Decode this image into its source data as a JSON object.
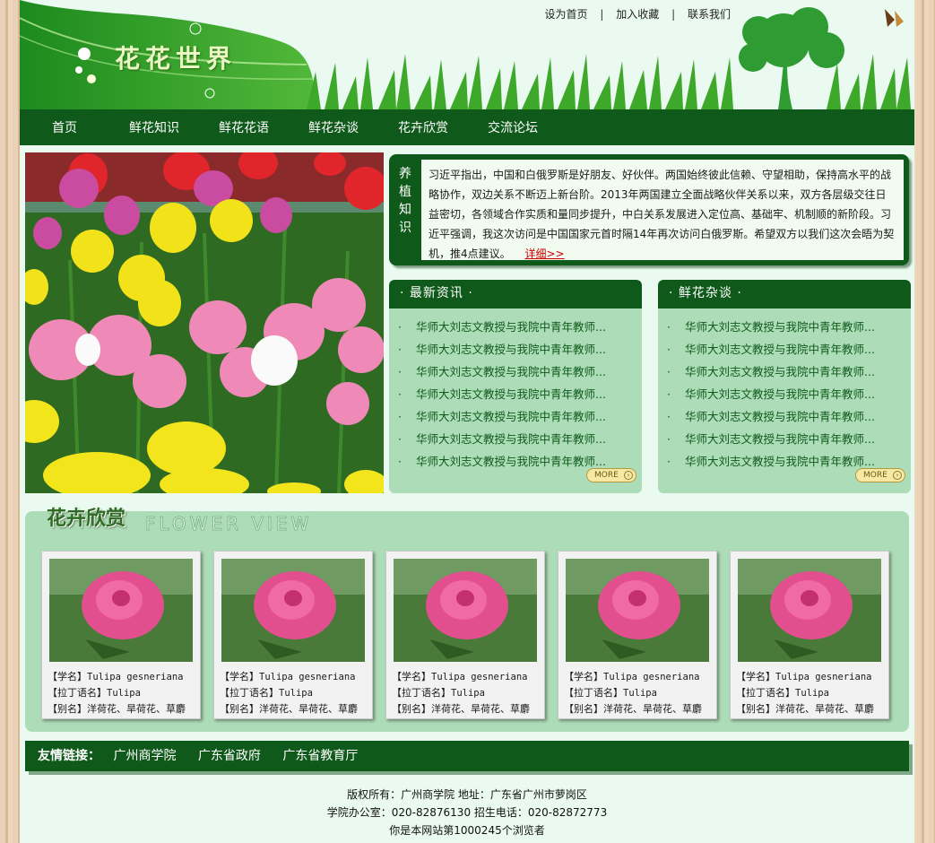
{
  "header": {
    "site_title": "花花世界",
    "top_links": [
      "设为首页",
      "加入收藏",
      "联系我们"
    ],
    "separator": "|"
  },
  "nav": [
    "首页",
    "鲜花知识",
    "鲜花花语",
    "鲜花杂谈",
    "花卉欣赏",
    "交流论坛"
  ],
  "care": {
    "label": [
      "养",
      "植",
      "知",
      "识"
    ],
    "text": "习近平指出，中国和白俄罗斯是好朋友、好伙伴。两国始终彼此信赖、守望相助，保持高水平的战略协作，双边关系不断迈上新台阶。2013年两国建立全面战略伙伴关系以来，双方各层级交往日益密切，各领域合作实质和量同步提升，中白关系发展进入定位高、基础牢、机制顺的新阶段。习近平强调，我这次访问是中国国家元首时隔14年再次访问白俄罗斯。希望双方以我们这次会晤为契机，推4点建议。",
    "more": "详细>>"
  },
  "panels": [
    {
      "title": "· 最新资讯 ·",
      "items": [
        "华师大刘志文教授与我院中青年教师...",
        "华师大刘志文教授与我院中青年教师...",
        "华师大刘志文教授与我院中青年教师...",
        "华师大刘志文教授与我院中青年教师...",
        "华师大刘志文教授与我院中青年教师...",
        "华师大刘志文教授与我院中青年教师...",
        "华师大刘志文教授与我院中青年教师..."
      ],
      "more": "MORE"
    },
    {
      "title": "· 鲜花杂谈 ·",
      "items": [
        "华师大刘志文教授与我院中青年教师...",
        "华师大刘志文教授与我院中青年教师...",
        "华师大刘志文教授与我院中青年教师...",
        "华师大刘志文教授与我院中青年教师...",
        "华师大刘志文教授与我院中青年教师...",
        "华师大刘志文教授与我院中青年教师...",
        "华师大刘志文教授与我院中青年教师..."
      ],
      "more": "MORE"
    }
  ],
  "list_bullet": "·",
  "flower_view": {
    "title_cn": "花卉欣赏",
    "title_en": "FLOWER VIEW",
    "cards": [
      {
        "l1k": "【学名】",
        "l1v": "Tulipa gesneriana",
        "l2k": "【拉丁语名】",
        "l2v": "Tulipa",
        "l3k": "【别名】",
        "l3v": "洋荷花、旱荷花、草麝"
      },
      {
        "l1k": "【学名】",
        "l1v": "Tulipa gesneriana",
        "l2k": "【拉丁语名】",
        "l2v": "Tulipa",
        "l3k": "【别名】",
        "l3v": "洋荷花、旱荷花、草麝"
      },
      {
        "l1k": "【学名】",
        "l1v": "Tulipa gesneriana",
        "l2k": "【拉丁语名】",
        "l2v": "Tulipa",
        "l3k": "【别名】",
        "l3v": "洋荷花、旱荷花、草麝"
      },
      {
        "l1k": "【学名】",
        "l1v": "Tulipa gesneriana",
        "l2k": "【拉丁语名】",
        "l2v": "Tulipa",
        "l3k": "【别名】",
        "l3v": "洋荷花、旱荷花、草麝"
      },
      {
        "l1k": "【学名】",
        "l1v": "Tulipa gesneriana",
        "l2k": "【拉丁语名】",
        "l2v": "Tulipa",
        "l3k": "【别名】",
        "l3v": "洋荷花、旱荷花、草麝"
      }
    ]
  },
  "links": {
    "label": "友情链接：",
    "items": [
      "广州商学院",
      "广东省政府",
      "广东省教育厅"
    ]
  },
  "footer": {
    "line1": "版权所有：广州商学院 地址：广东省广州市萝岗区",
    "line2": "学院办公室：020-82876130 招生电话：020-82872773",
    "line3": "你是本网站第1000245个浏览者"
  },
  "colors": {
    "nav_green": "#0f5a1a",
    "panel_green": "#acdcb8",
    "page_bg": "#eafaf0",
    "link_red": "#cc0000"
  }
}
